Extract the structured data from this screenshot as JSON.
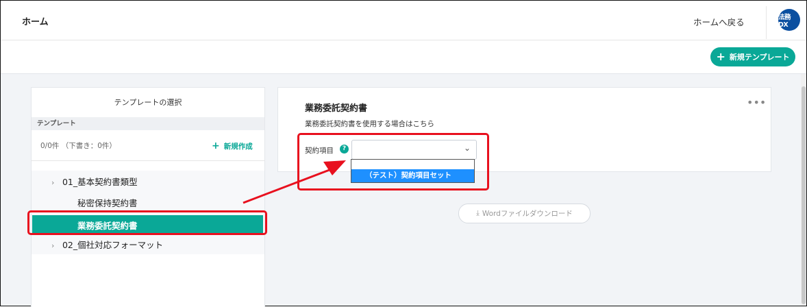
{
  "header": {
    "title": "ホーム",
    "back_link": "ホームへ戻る",
    "logo_text": "法務DX"
  },
  "toolbar": {
    "new_template_label": "新規テンプレート"
  },
  "sidebar": {
    "panel_title": "テンプレートの選択",
    "section_label": "テンプレート",
    "count_text": "0/0件 （下書き：0件）",
    "create_label": "新規作成",
    "tree": [
      {
        "label": "01_基本契約書類型",
        "children": [
          {
            "label": "秘密保持契約書"
          },
          {
            "label": "業務委託契約書",
            "selected": true
          }
        ]
      },
      {
        "label": "02_個社対応フォーマット"
      }
    ]
  },
  "main": {
    "card_title": "業務委託契約書",
    "card_description": "業務委託契約書を使用する場合はこちら",
    "field_label": "契約項目",
    "select_value": "",
    "dropdown_options": [
      "（テスト）契約項目セット"
    ],
    "word_button_label": "Wordファイルダウンロード"
  },
  "colors": {
    "accent": "#0aa897",
    "selected_option": "#1e90ff",
    "annotation": "#e8101e",
    "logo": "#0b4fa0"
  },
  "icons": [
    "plus-icon",
    "chevron-right-icon",
    "chevron-down-icon",
    "help-icon",
    "more-dots-icon",
    "download-icon"
  ]
}
